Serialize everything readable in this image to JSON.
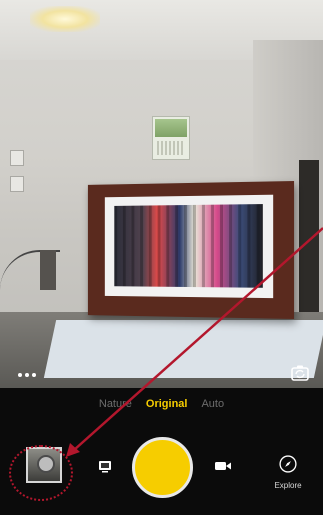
{
  "modes": [
    {
      "label": "Nature",
      "active": false
    },
    {
      "label": "Original",
      "active": true
    },
    {
      "label": "Auto",
      "active": false
    }
  ],
  "explore": {
    "label": "Explore"
  },
  "icons": {
    "more": "more-dots-icon",
    "flip": "flip-camera-icon",
    "photo": "photo-mode-icon",
    "video": "video-camera-icon",
    "explore": "compass-icon"
  },
  "colors": {
    "accent": "#f6cd00",
    "annotation": "#b3172d",
    "background": "#0b0b0b"
  }
}
